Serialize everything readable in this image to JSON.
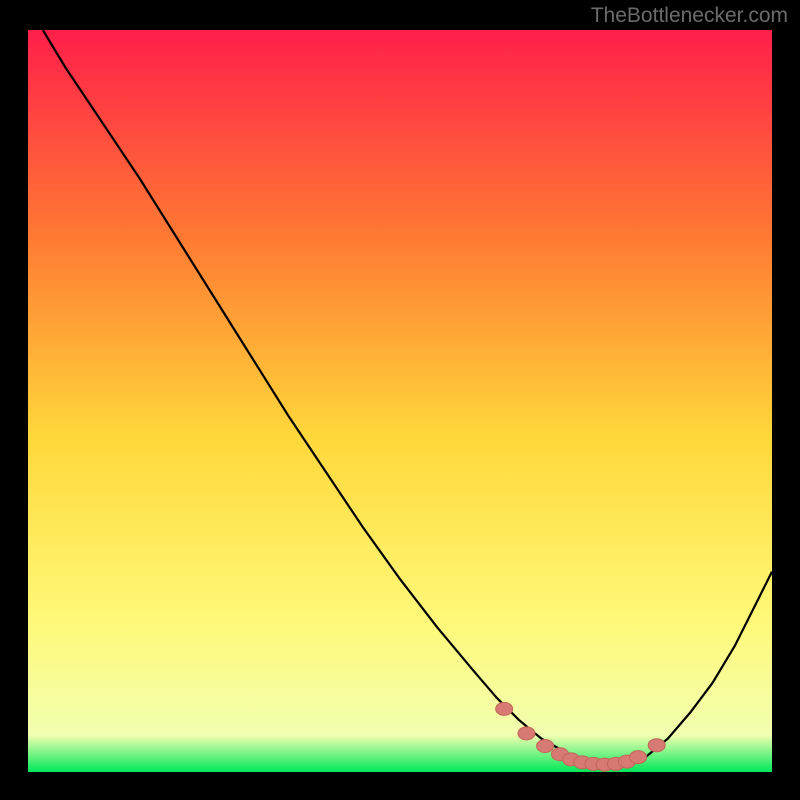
{
  "watermark": "TheBottlenecker.com",
  "colors": {
    "background": "#000000",
    "gradient_top": "#ff1f4a",
    "gradient_mid_upper": "#ff7a33",
    "gradient_mid": "#ffd83a",
    "gradient_lower": "#fff97a",
    "gradient_near_bottom": "#f2ffb0",
    "gradient_bottom": "#00e85a",
    "curve": "#000000",
    "marker_fill": "#d87a74",
    "marker_stroke": "#c46257"
  },
  "chart_data": {
    "type": "line",
    "title": "",
    "xlabel": "",
    "ylabel": "",
    "xlim": [
      0,
      100
    ],
    "ylim": [
      0,
      100
    ],
    "series": [
      {
        "name": "bottleneck-curve",
        "x": [
          2,
          5,
          10,
          15,
          20,
          25,
          30,
          35,
          40,
          45,
          50,
          55,
          60,
          63,
          66,
          69,
          72,
          74,
          76,
          78,
          80,
          83,
          86,
          89,
          92,
          95,
          98,
          100
        ],
        "y": [
          100,
          95,
          87.5,
          80,
          72,
          64,
          56,
          48,
          40.5,
          33,
          26,
          19.5,
          13.5,
          10,
          7,
          4.5,
          2.8,
          1.8,
          1.2,
          0.9,
          1.0,
          2.0,
          4.5,
          8,
          12,
          17,
          23,
          27
        ]
      }
    ],
    "markers": {
      "name": "highlight-dots",
      "x": [
        64,
        67,
        69.5,
        71.5,
        73,
        74.5,
        76,
        77.5,
        79,
        80.5,
        82,
        84.5
      ],
      "y": [
        8.5,
        5.2,
        3.5,
        2.4,
        1.7,
        1.3,
        1.1,
        1.0,
        1.1,
        1.4,
        2.0,
        3.6
      ]
    }
  }
}
